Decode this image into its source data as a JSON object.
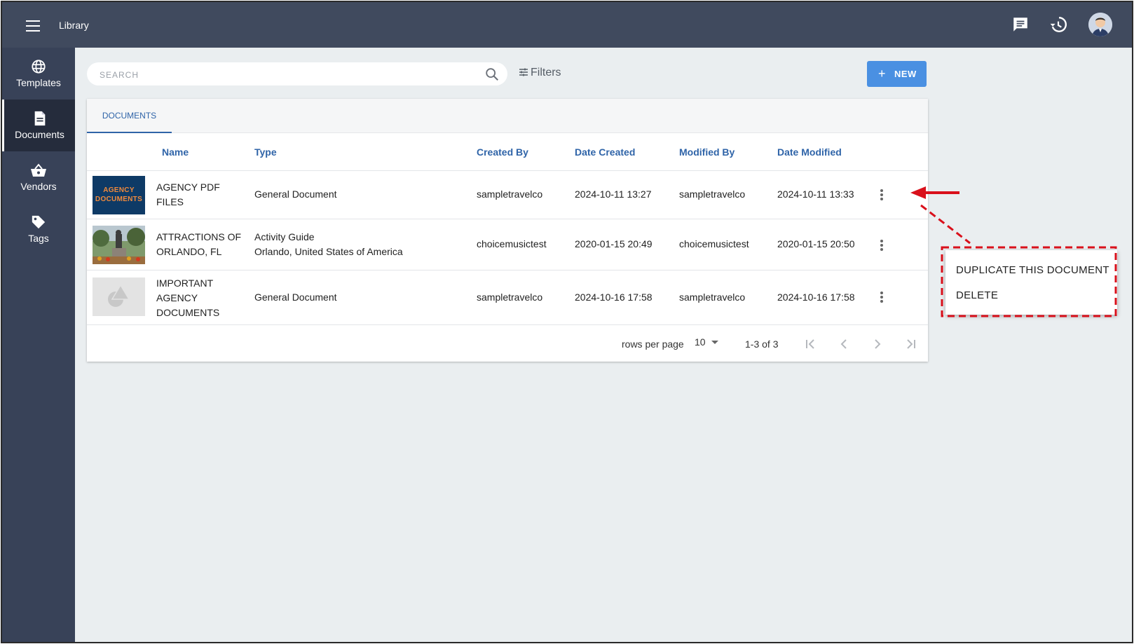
{
  "header": {
    "title": "Library",
    "icons": [
      "menu-icon",
      "chat-icon",
      "history-icon",
      "avatar"
    ]
  },
  "sidebar": {
    "items": [
      {
        "label": "Templates",
        "icon": "globe-icon",
        "active": false
      },
      {
        "label": "Documents",
        "icon": "document-icon",
        "active": true
      },
      {
        "label": "Vendors",
        "icon": "basket-icon",
        "active": false
      },
      {
        "label": "Tags",
        "icon": "tag-icon",
        "active": false
      }
    ]
  },
  "toolbar": {
    "search_placeholder": "SEARCH",
    "filters_label": "Filters",
    "new_label": "NEW"
  },
  "tabs": [
    {
      "label": "DOCUMENTS",
      "active": true
    }
  ],
  "table": {
    "columns": [
      "Name",
      "Type",
      "Created By",
      "Date Created",
      "Modified By",
      "Date Modified"
    ],
    "rows": [
      {
        "thumb_text": "AGENCY DOCUMENTS",
        "name_lines": [
          "AGENCY PDF",
          "FILES"
        ],
        "type_lines": [
          "General Document"
        ],
        "created_by": "sampletravelco",
        "date_created": "2024-10-11 13:27",
        "modified_by": "sampletravelco",
        "date_modified": "2024-10-11 13:33"
      },
      {
        "thumb_text": "",
        "name_lines": [
          "ATTRACTIONS OF",
          "ORLANDO, FL"
        ],
        "type_lines": [
          "Activity Guide",
          "Orlando, United States of America"
        ],
        "created_by": "choicemusictest",
        "date_created": "2020-01-15 20:49",
        "modified_by": "choicemusictest",
        "date_modified": "2020-01-15 20:50"
      },
      {
        "thumb_text": "",
        "name_lines": [
          "IMPORTANT",
          "AGENCY",
          "DOCUMENTS"
        ],
        "type_lines": [
          "General Document"
        ],
        "created_by": "sampletravelco",
        "date_created": "2024-10-16 17:58",
        "modified_by": "sampletravelco",
        "date_modified": "2024-10-16 17:58"
      }
    ]
  },
  "pagination": {
    "rows_per_page_label": "rows per page",
    "rows_per_page": "10",
    "range": "1-3 of 3"
  },
  "context_menu": {
    "items": [
      "DUPLICATE THIS DOCUMENT",
      "DELETE"
    ]
  },
  "colors": {
    "topbar": "#404a5e",
    "sidebar": "#384258",
    "accent": "#2f64a8",
    "new_button": "#4a90e2",
    "annotation": "#d9101b"
  }
}
